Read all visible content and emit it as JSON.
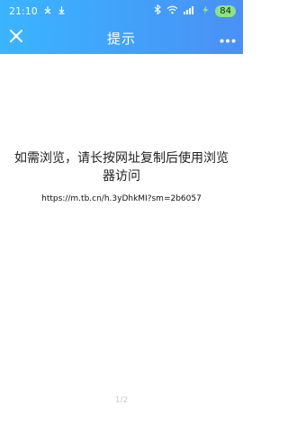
{
  "status_bar": {
    "time": "21:10",
    "battery": "84",
    "icons": [
      "usb-icon",
      "download-icon",
      "bluetooth-icon",
      "wifi-icon",
      "signal-icon",
      "battery-charging-icon"
    ]
  },
  "navbar": {
    "title": "提示",
    "close_icon": "close-icon",
    "more_icon": "more-icon"
  },
  "main": {
    "message": "如需浏览，请长按网址复制后使用浏览器访问",
    "url": "https://m.tb.cn/h.3yDhkMI?sm=2b6057",
    "page_indicator": "1/2"
  },
  "colors": {
    "topbar_gradient_start": "#3ab5ff",
    "topbar_gradient_end": "#4a90f5",
    "battery_fill": "#8fe08a"
  }
}
